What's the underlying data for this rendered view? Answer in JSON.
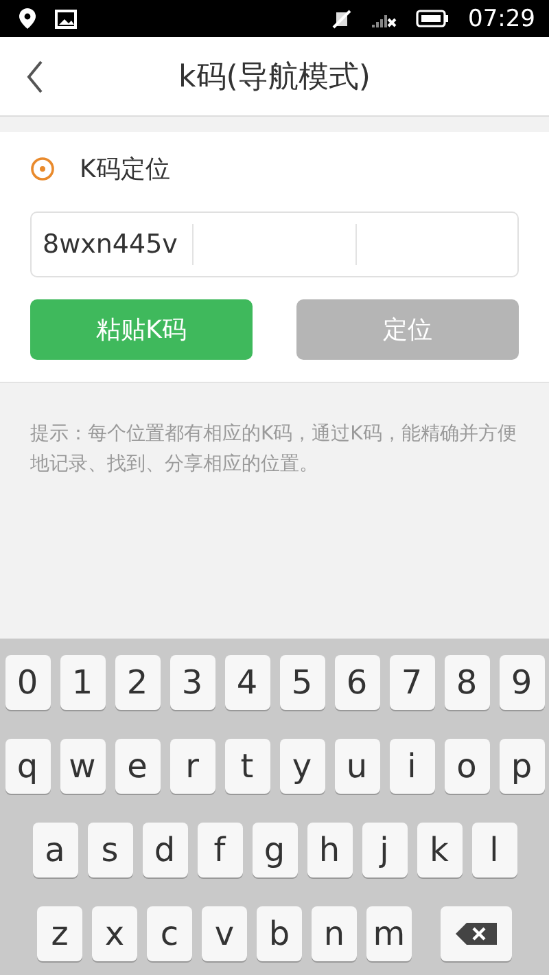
{
  "status_bar": {
    "time": "07:29"
  },
  "header": {
    "title": "k码(导航模式)"
  },
  "section": {
    "title": "K码定位"
  },
  "code_input": {
    "value": "8wxn445v"
  },
  "buttons": [
    {
      "label": "粘贴K码",
      "disabled": false
    },
    {
      "label": "定位",
      "disabled": true
    }
  ],
  "hint": "提示：每个位置都有相应的K码，通过K码，能精确并方便地记录、找到、分享相应的位置。",
  "keyboard": {
    "rows": [
      [
        "0",
        "1",
        "2",
        "3",
        "4",
        "5",
        "6",
        "7",
        "8",
        "9"
      ],
      [
        "q",
        "w",
        "e",
        "r",
        "t",
        "y",
        "u",
        "i",
        "o",
        "p"
      ],
      [
        "a",
        "s",
        "d",
        "f",
        "g",
        "h",
        "j",
        "k",
        "l"
      ],
      [
        "z",
        "x",
        "c",
        "v",
        "b",
        "n",
        "m"
      ]
    ]
  }
}
